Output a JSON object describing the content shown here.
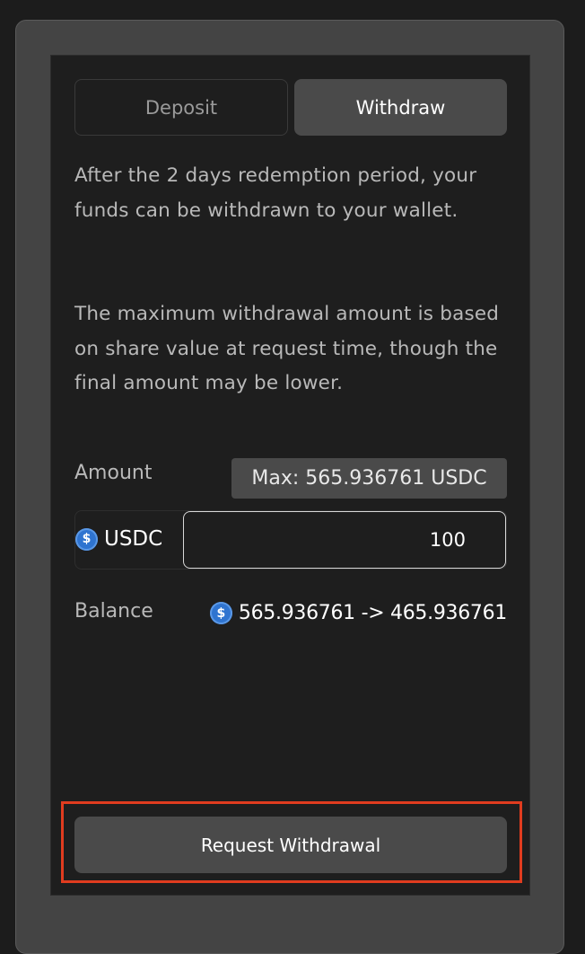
{
  "tabs": {
    "deposit_label": "Deposit",
    "withdraw_label": "Withdraw",
    "active": "Withdraw"
  },
  "description": {
    "paragraph1": "After the 2 days redemption period, your funds can be withdrawn to your wallet.",
    "paragraph2": "The maximum withdrawal amount is based on share value at request time, though the final amount may be lower."
  },
  "amount": {
    "label": "Amount",
    "max_label": "Max: 565.936761 USDC",
    "token": "USDC",
    "token_icon": "usdc-coin-icon",
    "value": "100"
  },
  "balance": {
    "label": "Balance",
    "change": "565.936761 -> 465.936761"
  },
  "actions": {
    "request_label": "Request Withdrawal"
  },
  "colors": {
    "background": "#1c1c1c",
    "card": "#444444",
    "panel": "#1e1e1e",
    "button": "#4a4a4a",
    "highlight": "#e03c1f",
    "usdc_blue": "#2f74d0"
  }
}
